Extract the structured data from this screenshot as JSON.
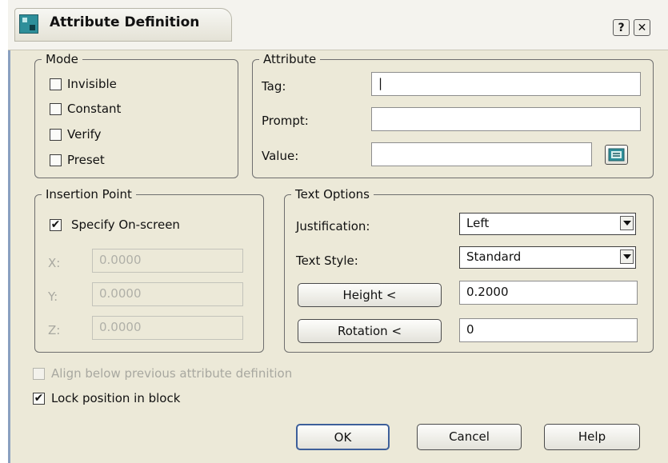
{
  "window": {
    "title": "Attribute Definition",
    "help_glyph": "?",
    "close_glyph": "✕"
  },
  "mode": {
    "legend": "Mode",
    "items": [
      {
        "label": "Invisible",
        "checked": false
      },
      {
        "label": "Constant",
        "checked": false
      },
      {
        "label": "Verify",
        "checked": false
      },
      {
        "label": "Preset",
        "checked": false
      }
    ]
  },
  "attribute": {
    "legend": "Attribute",
    "tag_label": "Tag:",
    "tag_value": "|",
    "prompt_label": "Prompt:",
    "prompt_value": "",
    "value_label": "Value:",
    "value_value": "",
    "field_button_icon": "insert-field-icon"
  },
  "insertion": {
    "legend": "Insertion Point",
    "specify_label": "Specify On-screen",
    "specify_checked": true,
    "x_label": "X:",
    "x_value": "0.0000",
    "y_label": "Y:",
    "y_value": "0.0000",
    "z_label": "Z:",
    "z_value": "0.0000"
  },
  "text_options": {
    "legend": "Text Options",
    "justification_label": "Justification:",
    "justification_value": "Left",
    "style_label": "Text Style:",
    "style_value": "Standard",
    "height_button": "Height <",
    "height_value": "0.2000",
    "rotation_button": "Rotation <",
    "rotation_value": "0"
  },
  "options": {
    "align_label": "Align below previous attribute definition",
    "align_checked": false,
    "lock_label": "Lock position in block",
    "lock_checked": true
  },
  "buttons": {
    "ok": "OK",
    "cancel": "Cancel",
    "help": "Help"
  },
  "colors": {
    "dialog_bg": "#ece9d8",
    "border": "#6e6e6e",
    "disabled": "#a8a8a0",
    "icon_accent": "#2e8f9a"
  }
}
